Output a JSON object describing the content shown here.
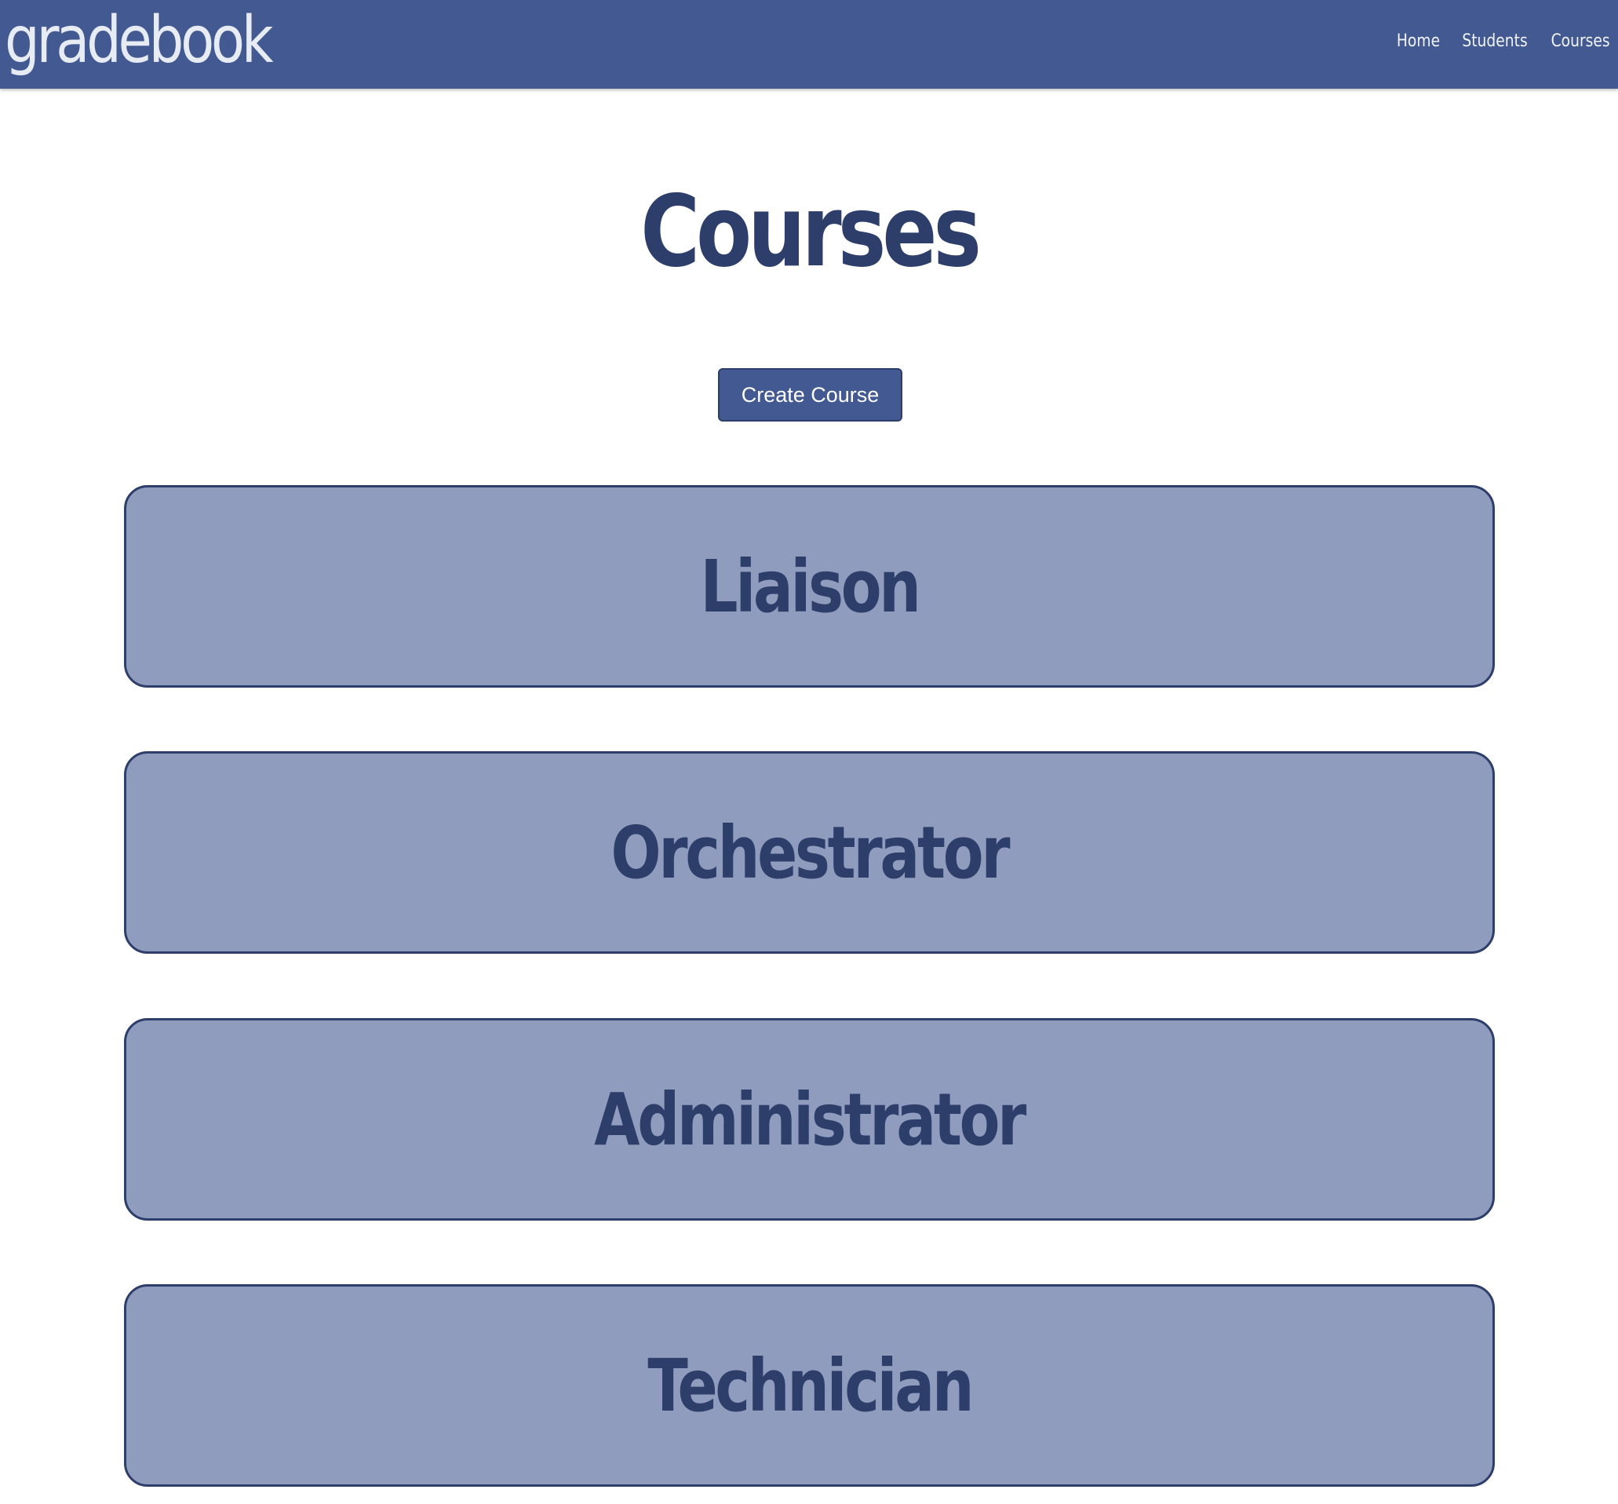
{
  "navbar": {
    "brand": "gradebook",
    "links": [
      "Home",
      "Students",
      "Courses"
    ]
  },
  "main": {
    "title": "Courses",
    "create_button_label": "Create Course",
    "courses": [
      "Liaison",
      "Orchestrator",
      "Administrator",
      "Technician"
    ]
  },
  "colors": {
    "navbar_bg": "#435991",
    "card_bg": "#8f9cbe",
    "text_dark": "#2e3e6b"
  }
}
